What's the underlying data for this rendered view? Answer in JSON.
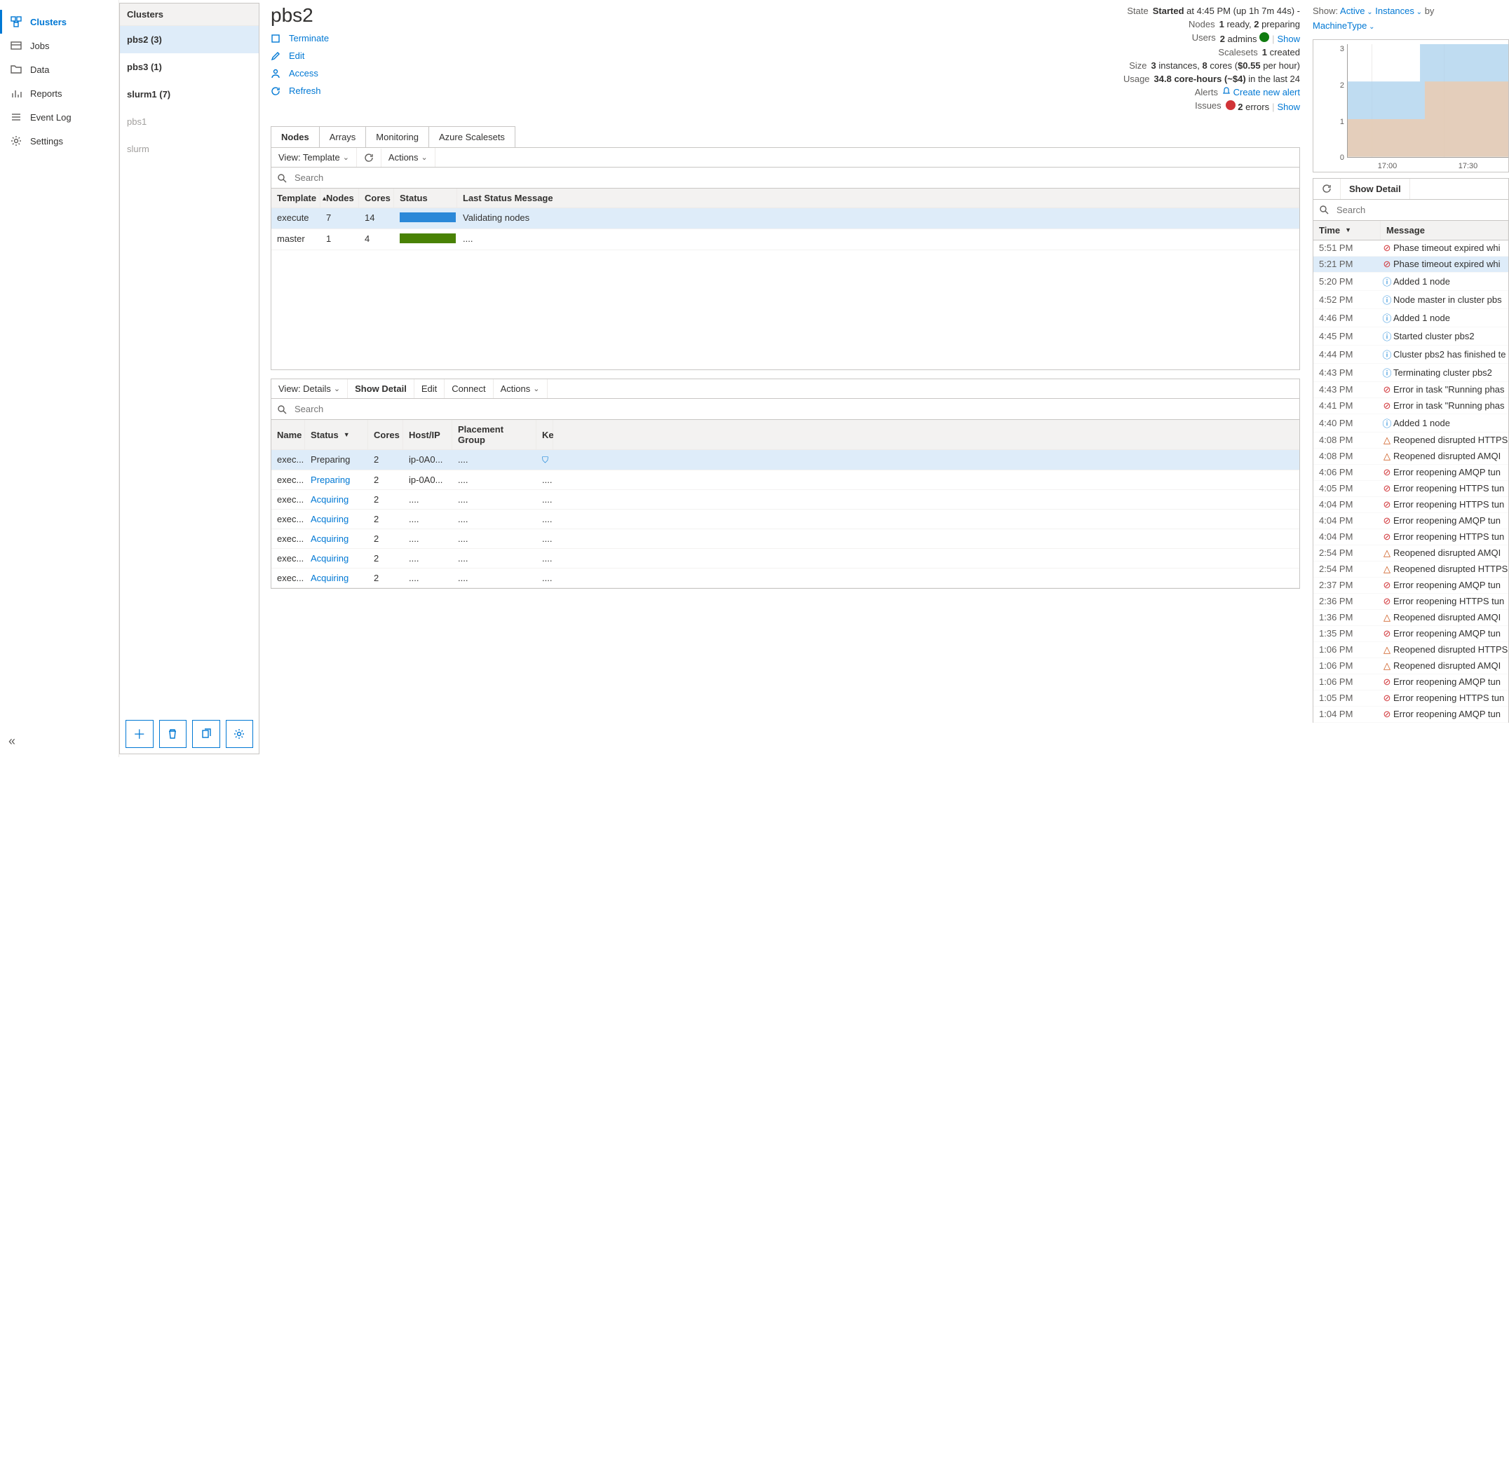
{
  "nav": {
    "items": [
      {
        "label": "Clusters",
        "icon": "clusters"
      },
      {
        "label": "Jobs",
        "icon": "jobs"
      },
      {
        "label": "Data",
        "icon": "data"
      },
      {
        "label": "Reports",
        "icon": "reports"
      },
      {
        "label": "Event Log",
        "icon": "eventlog"
      },
      {
        "label": "Settings",
        "icon": "settings"
      }
    ]
  },
  "clusters": {
    "header": "Clusters",
    "items": [
      {
        "label": "pbs2 (3)",
        "selected": true
      },
      {
        "label": "pbs3 (1)"
      },
      {
        "label": "slurm1 (7)"
      },
      {
        "label": "pbs1",
        "inactive": true
      },
      {
        "label": "slurm",
        "inactive": true
      }
    ]
  },
  "page": {
    "title": "pbs2",
    "actions": {
      "terminate": "Terminate",
      "edit": "Edit",
      "access": "Access",
      "refresh": "Refresh"
    },
    "info": {
      "state_label": "State",
      "state_value": "Started",
      "state_suffix": "at 4:45 PM (up 1h 7m 44s) -",
      "nodes_label": "Nodes",
      "nodes_value": "1 ready, 2 preparing",
      "users_label": "Users",
      "users_value": "2 admins",
      "users_show": "Show",
      "scalesets_label": "Scalesets",
      "scalesets_value": "1 created",
      "size_label": "Size",
      "size_value": "3 instances, 8 cores ($0.55 per hour)",
      "usage_label": "Usage",
      "usage_value": "34.8 core-hours (~$4) in the last 24",
      "alerts_label": "Alerts",
      "alerts_link": "Create new alert",
      "issues_label": "Issues",
      "issues_value": "2 errors",
      "issues_show": "Show"
    }
  },
  "tabs": {
    "nodes": "Nodes",
    "arrays": "Arrays",
    "monitoring": "Monitoring",
    "scalesets": "Azure Scalesets"
  },
  "template_toolbar": {
    "view": "View: Template",
    "actions": "Actions",
    "search_placeholder": "Search"
  },
  "template_table": {
    "headers": {
      "template": "Template",
      "nodes": "Nodes",
      "cores": "Cores",
      "status": "Status",
      "lsm": "Last Status Message"
    },
    "rows": [
      {
        "template": "execute",
        "nodes": "7",
        "cores": "14",
        "bar": "blue",
        "lsm": "Validating nodes"
      },
      {
        "template": "master",
        "nodes": "1",
        "cores": "4",
        "bar": "green",
        "lsm": "...."
      }
    ]
  },
  "detail_toolbar": {
    "view": "View: Details",
    "show_detail": "Show Detail",
    "edit": "Edit",
    "connect": "Connect",
    "actions": "Actions",
    "search_placeholder": "Search"
  },
  "detail_table": {
    "headers": {
      "name": "Name",
      "status": "Status",
      "cores": "Cores",
      "host": "Host/IP",
      "pg": "Placement Group",
      "kp": "Ke"
    },
    "rows": [
      {
        "name": "exec...",
        "status": "Preparing",
        "status_link": false,
        "cores": "2",
        "host": "ip-0A0...",
        "pg": "....",
        "shield": true
      },
      {
        "name": "exec...",
        "status": "Preparing",
        "status_link": true,
        "cores": "2",
        "host": "ip-0A0...",
        "pg": "....",
        "kp": "...."
      },
      {
        "name": "exec...",
        "status": "Acquiring",
        "status_link": true,
        "cores": "2",
        "host": "....",
        "pg": "....",
        "kp": "...."
      },
      {
        "name": "exec...",
        "status": "Acquiring",
        "status_link": true,
        "cores": "2",
        "host": "....",
        "pg": "....",
        "kp": "...."
      },
      {
        "name": "exec...",
        "status": "Acquiring",
        "status_link": true,
        "cores": "2",
        "host": "....",
        "pg": "....",
        "kp": "...."
      },
      {
        "name": "exec...",
        "status": "Acquiring",
        "status_link": true,
        "cores": "2",
        "host": "....",
        "pg": "....",
        "kp": "...."
      },
      {
        "name": "exec...",
        "status": "Acquiring",
        "status_link": true,
        "cores": "2",
        "host": "....",
        "pg": "....",
        "kp": "...."
      }
    ]
  },
  "right": {
    "show_label": "Show:",
    "dd1": "Active",
    "dd2": "Instances",
    "by": "by",
    "dd3": "MachineType",
    "refresh_btn": "⟳",
    "show_detail": "Show Detail",
    "search_placeholder": "Search",
    "col_time": "Time",
    "col_msg": "Message"
  },
  "chart_data": {
    "type": "area",
    "x_ticks": [
      "17:00",
      "17:30"
    ],
    "y_ticks": [
      0,
      1,
      2,
      3
    ],
    "ylim": [
      0,
      3
    ],
    "series": [
      {
        "name": "series-a",
        "color": "#a9d0ec",
        "points": [
          [
            0,
            2
          ],
          [
            0.45,
            2
          ],
          [
            0.45,
            3
          ],
          [
            1,
            3
          ]
        ]
      },
      {
        "name": "series-b",
        "color": "#f0c9a8",
        "points": [
          [
            0,
            1
          ],
          [
            0.48,
            1
          ],
          [
            0.48,
            2
          ],
          [
            1,
            2
          ]
        ]
      }
    ]
  },
  "events": [
    {
      "t": "5:51 PM",
      "type": "err",
      "m": "Phase timeout expired whi"
    },
    {
      "t": "5:21 PM",
      "type": "err",
      "m": "Phase timeout expired whi",
      "sel": true
    },
    {
      "t": "5:20 PM",
      "type": "info",
      "m": "Added 1 node"
    },
    {
      "t": "4:52 PM",
      "type": "info",
      "m": "Node master in cluster pbs"
    },
    {
      "t": "4:46 PM",
      "type": "info",
      "m": "Added 1 node"
    },
    {
      "t": "4:45 PM",
      "type": "info",
      "m": "Started cluster pbs2"
    },
    {
      "t": "4:44 PM",
      "type": "info",
      "m": "Cluster pbs2 has finished te"
    },
    {
      "t": "4:43 PM",
      "type": "info",
      "m": "Terminating cluster pbs2"
    },
    {
      "t": "4:43 PM",
      "type": "err",
      "m": "Error in task \"Running phas"
    },
    {
      "t": "4:41 PM",
      "type": "err",
      "m": "Error in task \"Running phas"
    },
    {
      "t": "4:40 PM",
      "type": "info",
      "m": "Added 1 node"
    },
    {
      "t": "4:08 PM",
      "type": "warn",
      "m": "Reopened disrupted HTTPS"
    },
    {
      "t": "4:08 PM",
      "type": "warn",
      "m": "Reopened disrupted AMQI"
    },
    {
      "t": "4:06 PM",
      "type": "err",
      "m": "Error reopening AMQP tun"
    },
    {
      "t": "4:05 PM",
      "type": "err",
      "m": "Error reopening HTTPS tun"
    },
    {
      "t": "4:04 PM",
      "type": "err",
      "m": "Error reopening HTTPS tun"
    },
    {
      "t": "4:04 PM",
      "type": "err",
      "m": "Error reopening AMQP tun"
    },
    {
      "t": "4:04 PM",
      "type": "err",
      "m": "Error reopening HTTPS tun"
    },
    {
      "t": "2:54 PM",
      "type": "warn",
      "m": "Reopened disrupted AMQI"
    },
    {
      "t": "2:54 PM",
      "type": "warn",
      "m": "Reopened disrupted HTTPS"
    },
    {
      "t": "2:37 PM",
      "type": "err",
      "m": "Error reopening AMQP tun"
    },
    {
      "t": "2:36 PM",
      "type": "err",
      "m": "Error reopening HTTPS tun"
    },
    {
      "t": "1:36 PM",
      "type": "warn",
      "m": "Reopened disrupted AMQI"
    },
    {
      "t": "1:35 PM",
      "type": "err",
      "m": "Error reopening AMQP tun"
    },
    {
      "t": "1:06 PM",
      "type": "warn",
      "m": "Reopened disrupted HTTPS"
    },
    {
      "t": "1:06 PM",
      "type": "warn",
      "m": "Reopened disrupted AMQI"
    },
    {
      "t": "1:06 PM",
      "type": "err",
      "m": "Error reopening AMQP tun"
    },
    {
      "t": "1:05 PM",
      "type": "err",
      "m": "Error reopening HTTPS tun"
    },
    {
      "t": "1:04 PM",
      "type": "err",
      "m": "Error reopening AMQP tun"
    }
  ]
}
